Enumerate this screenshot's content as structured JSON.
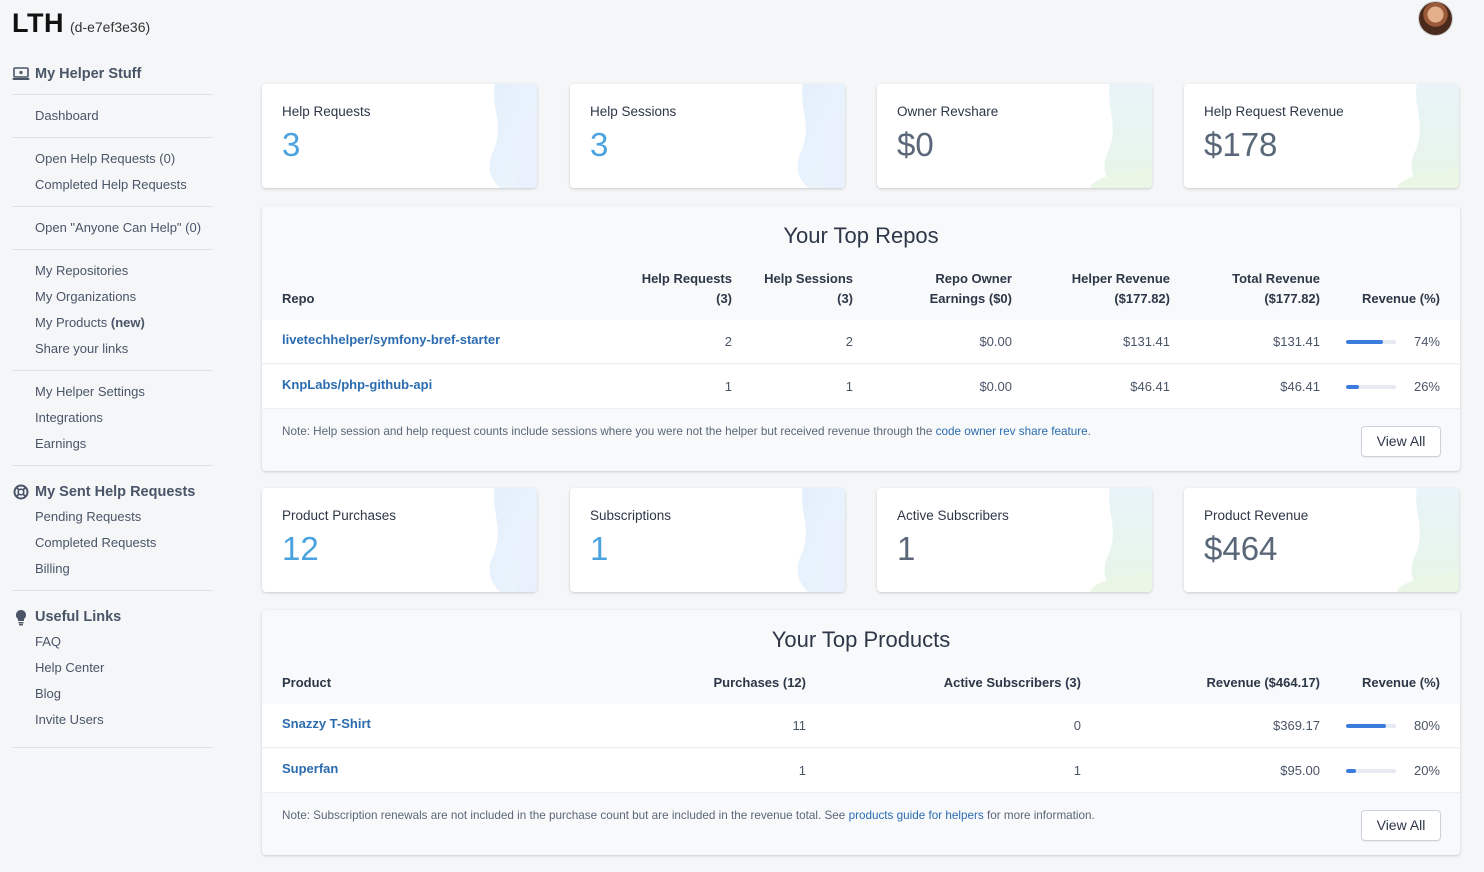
{
  "brand": {
    "logo": "LTH",
    "id": "(d-e7ef3e36)"
  },
  "sidebar": {
    "section1_title": "My Helper Stuff",
    "dashboard": "Dashboard",
    "open_requests": "Open Help Requests (0)",
    "completed_requests": "Completed Help Requests",
    "anyone_can_help": "Open \"Anyone Can Help\" (0)",
    "repositories": "My Repositories",
    "organizations": "My Organizations",
    "products": "My Products",
    "products_badge": "(new)",
    "share_links": "Share your links",
    "settings": "My Helper Settings",
    "integrations": "Integrations",
    "earnings": "Earnings",
    "section2_title": "My Sent Help Requests",
    "pending": "Pending Requests",
    "completed_sent": "Completed Requests",
    "billing": "Billing",
    "section3_title": "Useful Links",
    "faq": "FAQ",
    "help_center": "Help Center",
    "blog": "Blog",
    "invite": "Invite Users"
  },
  "stats_top": [
    {
      "label": "Help Requests",
      "value": "3"
    },
    {
      "label": "Help Sessions",
      "value": "3"
    },
    {
      "label": "Owner Revshare",
      "value": "$0"
    },
    {
      "label": "Help Request Revenue",
      "value": "$178"
    }
  ],
  "repos": {
    "title": "Your Top Repos",
    "headers": {
      "repo": "Repo",
      "help_requests_1": "Help Requests",
      "help_requests_2": "(3)",
      "help_sessions_1": "Help Sessions",
      "help_sessions_2": "(3)",
      "owner_earnings_1": "Repo Owner",
      "owner_earnings_2": "Earnings ($0)",
      "helper_revenue_1": "Helper Revenue",
      "helper_revenue_2": "($177.82)",
      "total_revenue_1": "Total Revenue",
      "total_revenue_2": "($177.82)",
      "revenue_pct": "Revenue (%)"
    },
    "rows": [
      {
        "name": "livetechhelper/symfony-bref-starter",
        "requests": "2",
        "sessions": "2",
        "owner": "$0.00",
        "helper": "$131.41",
        "total": "$131.41",
        "pct": "74%",
        "pct_value": 0.74
      },
      {
        "name": "KnpLabs/php-github-api",
        "requests": "1",
        "sessions": "1",
        "owner": "$0.00",
        "helper": "$46.41",
        "total": "$46.41",
        "pct": "26%",
        "pct_value": 0.26
      }
    ],
    "note_text": "Note: Help session and help request counts include sessions where you were not the helper but received revenue through the ",
    "note_link": "code owner rev share feature",
    "note_end": ".",
    "view_all": "View All"
  },
  "stats_bottom": [
    {
      "label": "Product Purchases",
      "value": "12"
    },
    {
      "label": "Subscriptions",
      "value": "1"
    },
    {
      "label": "Active Subscribers",
      "value": "1"
    },
    {
      "label": "Product Revenue",
      "value": "$464"
    }
  ],
  "products": {
    "title": "Your Top Products",
    "headers": {
      "product": "Product",
      "purchases": "Purchases (12)",
      "subscribers": "Active Subscribers (3)",
      "revenue": "Revenue ($464.17)",
      "revenue_pct": "Revenue (%)"
    },
    "rows": [
      {
        "name": "Snazzy T-Shirt",
        "purchases": "11",
        "subscribers": "0",
        "revenue": "$369.17",
        "pct": "80%",
        "pct_value": 0.8
      },
      {
        "name": "Superfan",
        "purchases": "1",
        "subscribers": "1",
        "revenue": "$95.00",
        "pct": "20%",
        "pct_value": 0.2
      }
    ],
    "note_text": "Note: Subscription renewals are not included in the purchase count but are included in the revenue total. See ",
    "note_link": "products guide for helpers",
    "note_end": " for more information.",
    "view_all": "View All"
  },
  "colors": {
    "accent": "#3b7ddd",
    "link": "#2b6cb0",
    "stat_blue": "#4aa3df",
    "stat_gray": "#5a6778"
  }
}
